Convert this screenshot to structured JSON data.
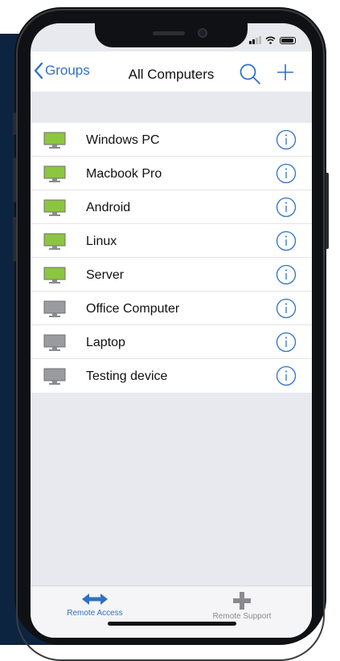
{
  "colors": {
    "accent": "#2f72c4",
    "online": "#8cc63f",
    "offline": "#9a9b9f"
  },
  "header": {
    "back_label": "Groups",
    "title": "All Computers"
  },
  "devices": [
    {
      "name": "Windows PC",
      "status": "online"
    },
    {
      "name": "Macbook Pro",
      "status": "online"
    },
    {
      "name": "Android",
      "status": "online"
    },
    {
      "name": "Linux",
      "status": "online"
    },
    {
      "name": "Server",
      "status": "online"
    },
    {
      "name": "Office Computer",
      "status": "offline"
    },
    {
      "name": "Laptop",
      "status": "offline"
    },
    {
      "name": "Testing device",
      "status": "offline"
    }
  ],
  "tabs": [
    {
      "label": "Remote Access",
      "icon": "double-arrow-icon",
      "active": true
    },
    {
      "label": "Remote Support",
      "icon": "plus-icon",
      "active": false
    }
  ]
}
